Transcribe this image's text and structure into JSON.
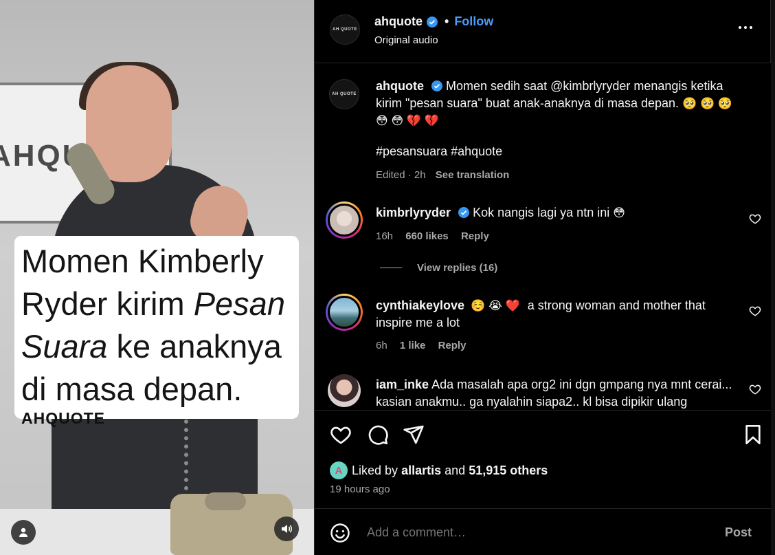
{
  "media": {
    "sign_text": "AHQUOTE",
    "caption": {
      "line1": "Momen Kimberly",
      "line2a": "Ryder kirim ",
      "line2b": "Pesan",
      "line3a": "Suara",
      "line3b": " ke anaknya",
      "line4": "di masa depan.",
      "brand": "AHQUOTE"
    },
    "icons": {
      "user_tag": "person-icon",
      "sound": "speaker-icon"
    }
  },
  "header": {
    "avatar_text": "AH QUOTE",
    "username": "ahquote",
    "separator": "•",
    "follow_label": "Follow",
    "subtitle": "Original audio"
  },
  "caption": {
    "username": "ahquote",
    "text": "Momen sedih saat @kimbrlyryder menangis ketika kirim \"pesan suara\" buat anak-anaknya di masa depan.",
    "emojis": "🥺 🥺 🥺 😳 😳 💔 💔",
    "hashtags": "#pesansuara #ahquote",
    "edited": "Edited · 2h",
    "see_translation": "See translation"
  },
  "comments": [
    {
      "username": "kimbrlyryder",
      "text": "Kok nangis lagi ya ntn ini",
      "emoji": "😳",
      "time": "16h",
      "likes": "660 likes",
      "reply": "Reply",
      "verified": true
    },
    {
      "username": "cynthiakeylove",
      "text_prefix": "☺️ 😭 ❤️",
      "text": "a strong woman and mother that inspire me a lot",
      "time": "6h",
      "likes": "1 like",
      "reply": "Reply",
      "verified": false
    },
    {
      "username": "iam_inke",
      "text": "Ada masalah apa org2 ini dgn gmpang nya mnt cerai... kasian anakmu.. ga nyalahin siapa2.. kl bisa dipikir ulang",
      "verified": false
    }
  ],
  "view_replies": "View replies (16)",
  "actions": {
    "liked_by_prefix": "Liked by",
    "liked_by_user": "allartis",
    "liked_by_and": "and",
    "liked_by_count": "51,915 others",
    "liked_avatar_letter": "A",
    "time_ago": "19 hours ago",
    "comment_placeholder": "Add a comment…",
    "post_label": "Post"
  },
  "colors": {
    "background": "#000000",
    "text": "#f5f5f5",
    "secondary_text": "#a8a8a8",
    "follow_blue": "#4a9cf7",
    "divider": "#262626"
  }
}
